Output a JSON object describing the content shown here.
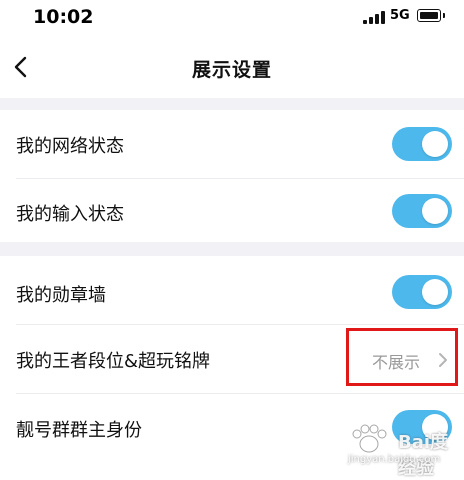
{
  "status_bar": {
    "time": "10:02",
    "network": "5G"
  },
  "nav": {
    "title": "展示设置",
    "back_icon": "chevron-left-icon"
  },
  "settings": {
    "network_status": {
      "label": "我的网络状态",
      "enabled": true
    },
    "input_status": {
      "label": "我的输入状态",
      "enabled": true
    },
    "badge_wall": {
      "label": "我的勋章墙",
      "enabled": true
    },
    "rank_badge": {
      "label": "我的王者段位&超玩铭牌",
      "value": "不展示",
      "icon": "chevron-right-icon"
    },
    "group_owner": {
      "label": "靓号群群主身份",
      "enabled": true
    }
  },
  "annotation": {
    "color": "#e11818"
  },
  "watermark": {
    "text": "Bai度经验",
    "url": "jingyan.baidu.com"
  },
  "colors": {
    "toggle_on": "#4db8ec",
    "section_bg": "#f2f2f6"
  }
}
